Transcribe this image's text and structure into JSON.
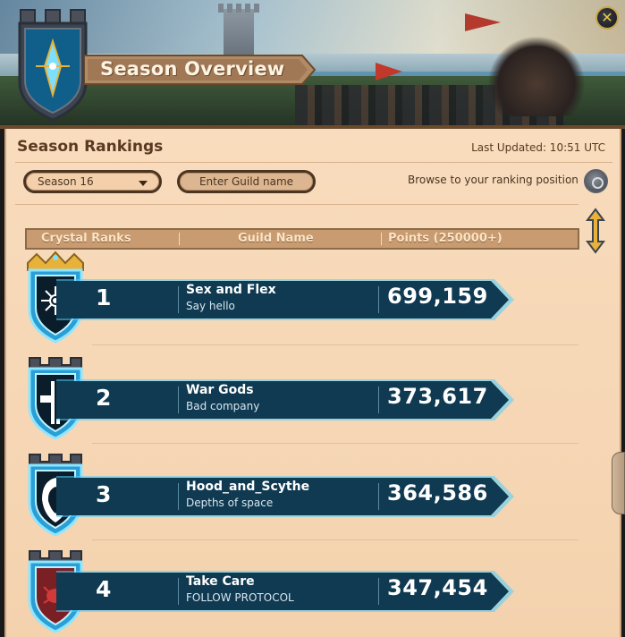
{
  "header": {
    "title": "Season Overview",
    "close_icon": "close-icon",
    "crest_icon": "crystal-crest-icon"
  },
  "panel": {
    "heading": "Season Rankings",
    "last_updated": "Last Updated: 10:51 UTC",
    "season_select": {
      "value": "Season 16"
    },
    "guild_search": {
      "placeholder": "Enter Guild name"
    },
    "browse_label": "Browse to your ranking position",
    "browse_icon": "target-icon"
  },
  "table": {
    "columns": [
      "Crystal Ranks",
      "Guild Name",
      "Points (250000+)"
    ],
    "rows": [
      {
        "rank": "1",
        "guild": "Sex and Flex",
        "motto": "Say hello",
        "points": "699,159",
        "emblem": "sun-emblem-icon"
      },
      {
        "rank": "2",
        "guild": "War Gods",
        "motto": "Bad company",
        "points": "373,617",
        "emblem": "cross-emblem-icon"
      },
      {
        "rank": "3",
        "guild": "Hood_and_Scythe",
        "motto": "Depths of space",
        "points": "364,586",
        "emblem": "hood-emblem-icon"
      },
      {
        "rank": "4",
        "guild": "Take Care",
        "motto": "FOLLOW PROTOCOL",
        "points": "347,454",
        "emblem": "crab-emblem-icon"
      }
    ]
  },
  "colors": {
    "parchment": "#f6d5b3",
    "banner_teal": "#0f3a52",
    "banner_glow": "#4fd0ff",
    "gold": "#e8b23a",
    "text_brown": "#5a3a22"
  }
}
